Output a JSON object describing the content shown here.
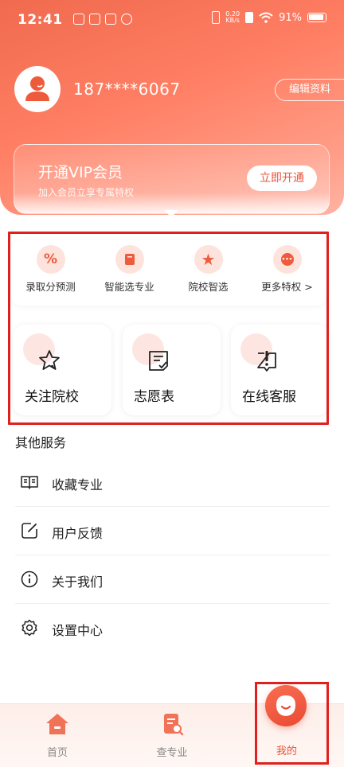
{
  "status_bar": {
    "time": "12:41",
    "net_speed_value": "0.20",
    "net_speed_unit": "KB/s",
    "battery": "91%"
  },
  "profile": {
    "phone": "187****6067",
    "edit_label": "编辑资料"
  },
  "vip": {
    "title": "开通VIP会员",
    "subtitle": "加入会员立享专属特权",
    "button_label": "立即开通"
  },
  "privileges": [
    {
      "label": "录取分预测",
      "icon": "percent-icon",
      "glyph": "%"
    },
    {
      "label": "智能选专业",
      "icon": "book-icon",
      "glyph": ""
    },
    {
      "label": "院校智选",
      "icon": "star-icon",
      "glyph": "★"
    },
    {
      "label": "更多特权 >",
      "icon": "more-icon",
      "glyph": "•••"
    }
  ],
  "features": [
    {
      "label": "关注院校",
      "icon": "star-outline-icon"
    },
    {
      "label": "志愿表",
      "icon": "form-icon"
    },
    {
      "label": "在线客服",
      "icon": "support-icon"
    }
  ],
  "other_services": {
    "title": "其他服务",
    "items": [
      {
        "label": "收藏专业",
        "icon": "book-open-icon"
      },
      {
        "label": "用户反馈",
        "icon": "edit-icon"
      },
      {
        "label": "关于我们",
        "icon": "info-icon"
      },
      {
        "label": "设置中心",
        "icon": "gear-icon"
      }
    ]
  },
  "tabbar": {
    "items": [
      {
        "label": "首页",
        "icon": "home-icon"
      },
      {
        "label": "查专业",
        "icon": "search-doc-icon"
      },
      {
        "label": "我的",
        "icon": "profile-smile-icon"
      }
    ],
    "active_index": 2
  },
  "colors": {
    "accent": "#ee5a3c",
    "highlight_border": "#e0201e"
  }
}
